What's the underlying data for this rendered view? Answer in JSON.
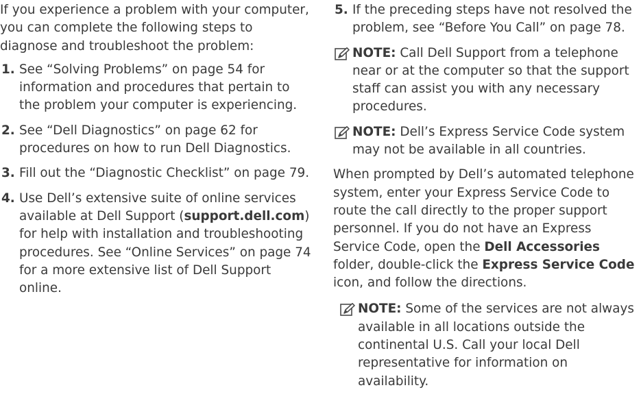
{
  "left_column": {
    "intro": "If you experience a problem with your computer, you can complete the following steps to diagnose and troubleshoot the problem:",
    "steps": [
      {
        "num": "1.",
        "text": "See “Solving Problems” on page 54 for information and procedures that pertain to the problem your computer is experiencing."
      },
      {
        "num": "2.",
        "text": "See “Dell Diagnostics” on page 62 for procedures on how to run Dell Diagnostics."
      },
      {
        "num": "3.",
        "text": "Fill out the “Diagnostic Checklist” on page 79."
      },
      {
        "num": "4.",
        "text_before": "Use Dell’s extensive suite of online services available at Dell Support (",
        "link": "support.dell.com",
        "text_after": ") for help with installation and troubleshooting procedures. See “Online Services” on page 74 for a more extensive list of Dell Support online."
      }
    ]
  },
  "right_column": {
    "step5": {
      "num": "5.",
      "text": "If the preceding steps have not resolved the problem, see “Before You Call” on page 78."
    },
    "notes": [
      {
        "label": "NOTE:",
        "text": " Call Dell Support from a telephone near or at the computer so that the support staff can assist you with any necessary procedures."
      },
      {
        "label": "NOTE:",
        "text": " Dell’s Express Service Code system may not be available in all countries."
      },
      {
        "label": "NOTE:",
        "text": " Some of the services are not always available in all locations outside the continental U.S. Call your local Dell representative for information on availability."
      }
    ],
    "paragraph": {
      "part1": "When prompted by Dell’s automated telephone system, enter your Express Service Code to route the call directly to the proper support personnel. If you do not have an Express Service Code, open the ",
      "bold1": "Dell Accessories",
      "part2": " folder, double-click the ",
      "bold2": "Express Service Code",
      "part3": " icon, and follow the directions."
    }
  },
  "icons": {
    "note": "pencil-note-icon"
  }
}
